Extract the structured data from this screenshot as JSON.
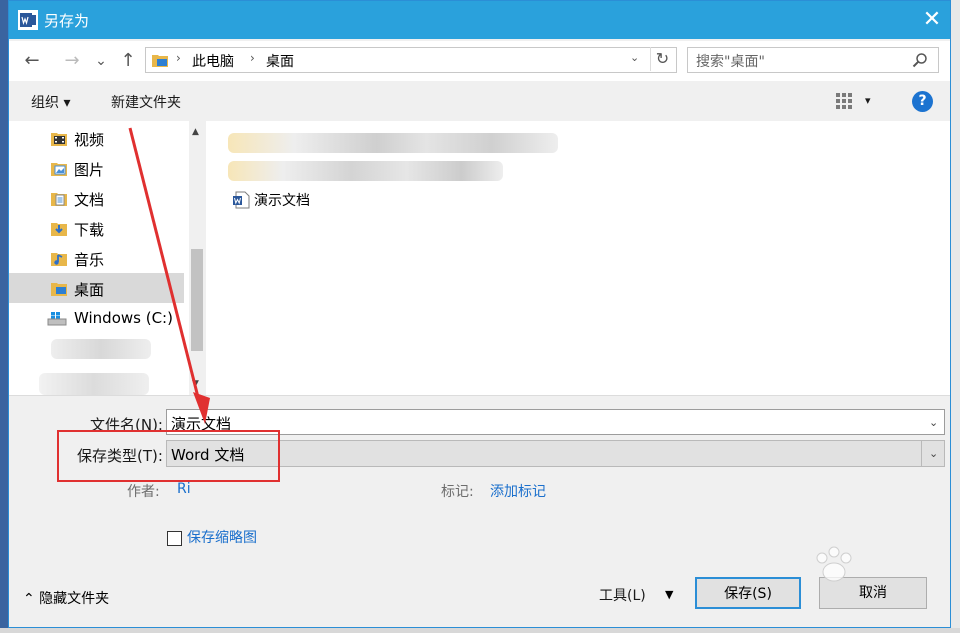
{
  "window": {
    "title": "另存为",
    "close_glyph": "✕"
  },
  "address_bar": {
    "back_glyph": "←",
    "forward_glyph": "→",
    "recent_glyph": "⌄",
    "up_glyph": "↑",
    "breadcrumbs": [
      "此电脑",
      "桌面"
    ],
    "crumb_sep": "›",
    "dropdown_glyph": "⌄",
    "refresh_glyph": "↻"
  },
  "search": {
    "placeholder": "搜索\"桌面\""
  },
  "toolbar": {
    "organize": "组织 ▾",
    "new_folder": "新建文件夹",
    "view_dd": "▾",
    "help": "?"
  },
  "nav": {
    "items": [
      {
        "label": "视频",
        "icon": "video-folder-icon"
      },
      {
        "label": "图片",
        "icon": "pictures-folder-icon"
      },
      {
        "label": "文档",
        "icon": "documents-folder-icon"
      },
      {
        "label": "下载",
        "icon": "downloads-folder-icon"
      },
      {
        "label": "音乐",
        "icon": "music-folder-icon"
      },
      {
        "label": "桌面",
        "icon": "desktop-folder-icon",
        "selected": true
      },
      {
        "label": "Windows (C:)",
        "icon": "drive-icon"
      }
    ],
    "scroll_up": "▲",
    "scroll_down": "▼"
  },
  "files": {
    "items": [
      {
        "label": "演示文档",
        "icon": "word-document-icon"
      }
    ]
  },
  "form": {
    "filename_label": "文件名(N):",
    "filename_value": "演示文档",
    "filetype_label": "保存类型(T):",
    "filetype_value": "Word 文档",
    "dropdown_glyph": "⌄",
    "author_label": "作者:",
    "author_value": "Ri",
    "tags_label": "标记:",
    "tags_value": "添加标记",
    "thumbnail_label": "保存缩略图"
  },
  "footer": {
    "hide_folders": "⌃  隐藏文件夹",
    "tools": "工具(L)",
    "tools_dd": "▼",
    "save": "保存(S)",
    "cancel": "取消"
  },
  "colors": {
    "title_bar": "#2aa1dc",
    "annotation_red": "#e03030",
    "link_blue": "#1a6fcc"
  }
}
